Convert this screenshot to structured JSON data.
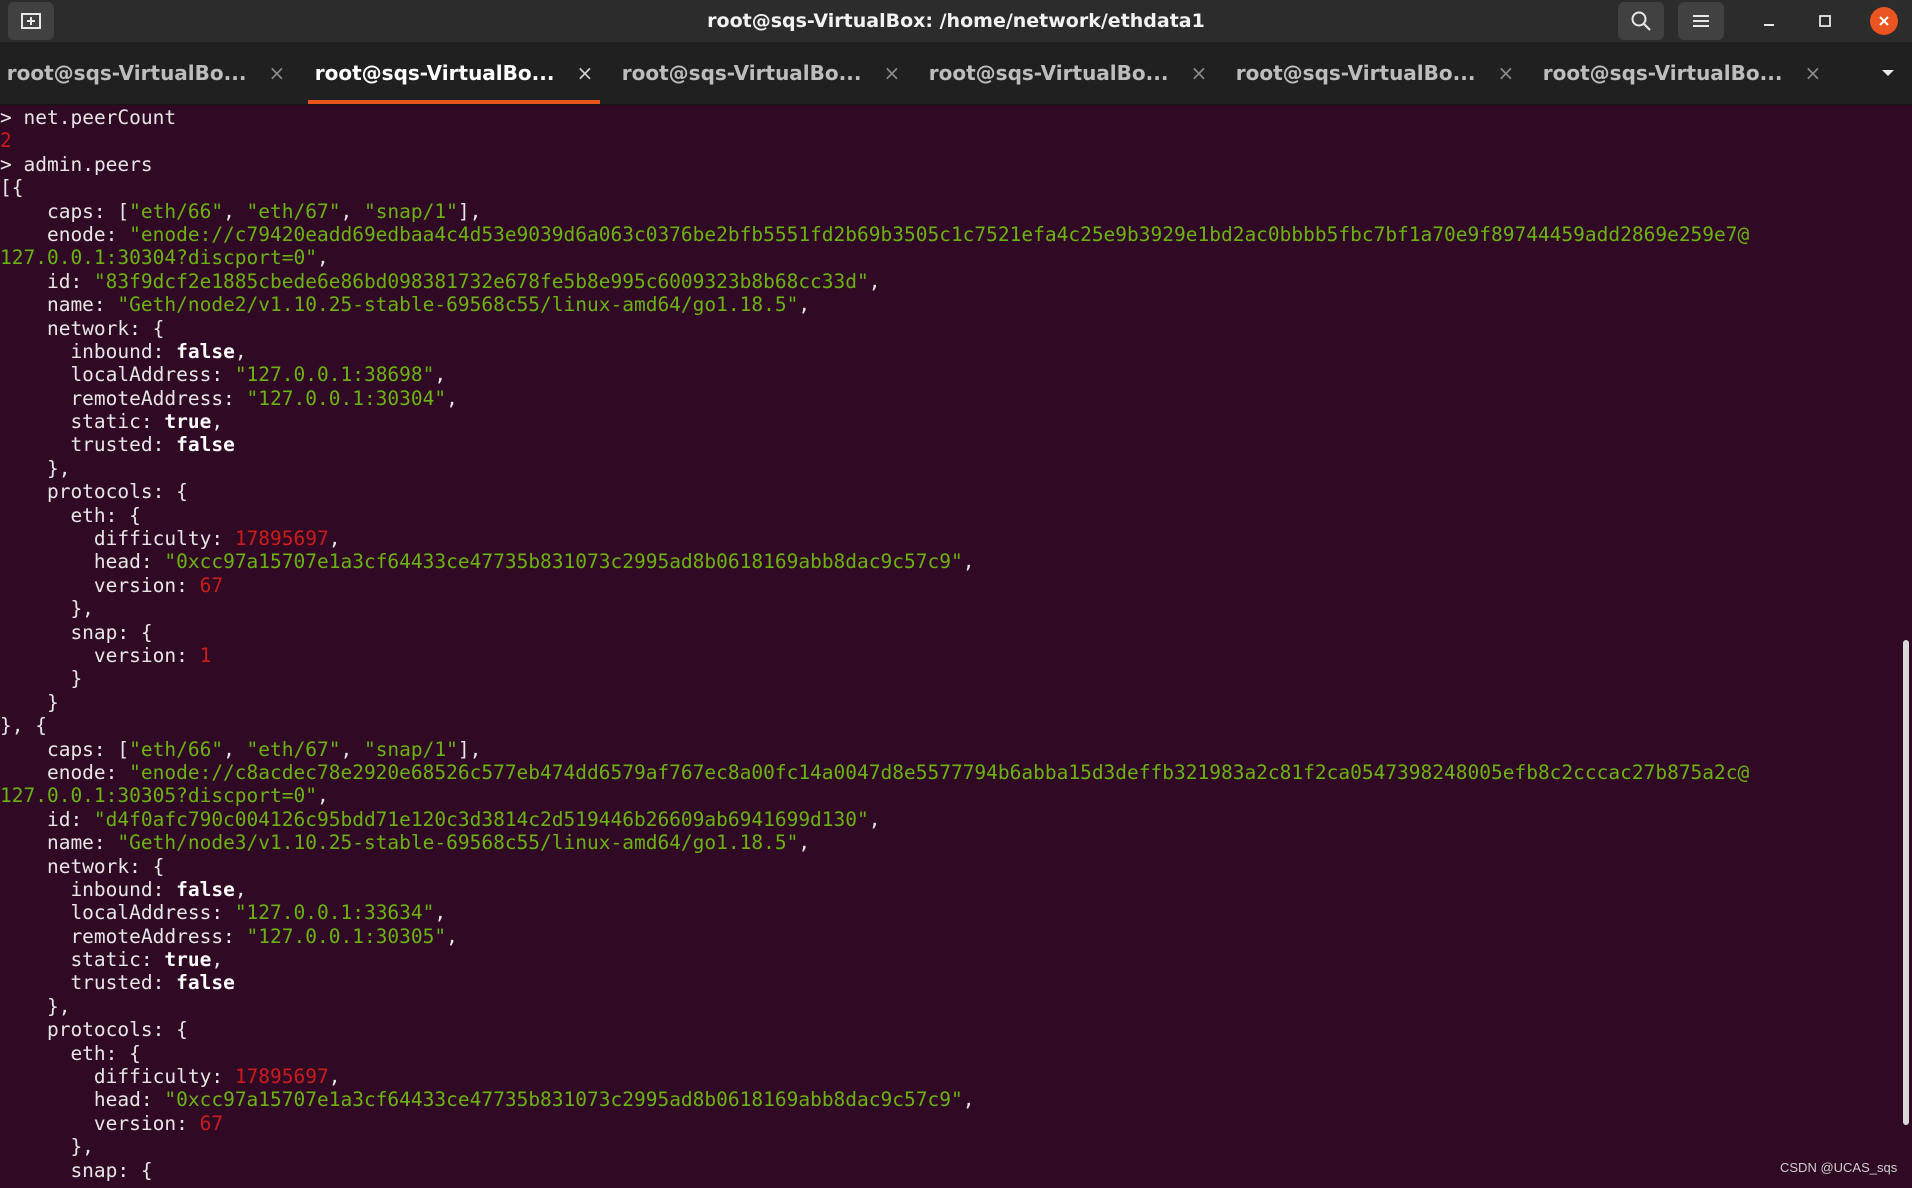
{
  "window": {
    "title": "root@sqs-VirtualBox: /home/network/ethdata1"
  },
  "tabs": [
    {
      "label": "root@sqs-VirtualBo...",
      "active": false
    },
    {
      "label": "root@sqs-VirtualBo...",
      "active": true
    },
    {
      "label": "root@sqs-VirtualBo...",
      "active": false
    },
    {
      "label": "root@sqs-VirtualBo...",
      "active": false
    },
    {
      "label": "root@sqs-VirtualBo...",
      "active": false
    },
    {
      "label": "root@sqs-VirtualBo...",
      "active": false
    }
  ],
  "tab_close_glyph": "×",
  "terminal": {
    "prompt": ">",
    "cmd1": "net.peerCount",
    "peer_count": "2",
    "cmd2": "admin.peers",
    "peers": [
      {
        "caps": [
          "\"eth/66\"",
          "\"eth/67\"",
          "\"snap/1\""
        ],
        "enode_line1": "\"enode://c79420eadd69edbaa4c4d53e9039d6a063c0376be2bfb5551fd2b69b3505c1c7521efa4c25e9b3929e1bd2ac0bbbb5fbc7bf1a70e9f89744459add2869e259e7@",
        "enode_line2": "127.0.0.1:30304?discport=0\"",
        "id": "\"83f9dcf2e1885cbede6e86bd098381732e678fe5b8e995c6009323b8b68cc33d\"",
        "name": "\"Geth/node2/v1.10.25-stable-69568c55/linux-amd64/go1.18.5\"",
        "inbound": "false",
        "localAddress": "\"127.0.0.1:38698\"",
        "remoteAddress": "\"127.0.0.1:30304\"",
        "static": "true",
        "trusted": "false",
        "difficulty": "17895697",
        "head": "\"0xcc97a15707e1a3cf64433ce47735b831073c2995ad8b0618169abb8dac9c57c9\"",
        "eth_version": "67",
        "snap_version": "1"
      },
      {
        "caps": [
          "\"eth/66\"",
          "\"eth/67\"",
          "\"snap/1\""
        ],
        "enode_line1": "\"enode://c8acdec78e2920e68526c577eb474dd6579af767ec8a00fc14a0047d8e5577794b6abba15d3deffb321983a2c81f2ca0547398248005efb8c2cccac27b875a2c@",
        "enode_line2": "127.0.0.1:30305?discport=0\"",
        "id": "\"d4f0afc790c004126c95bdd71e120c3d3814c2d519446b26609ab6941699d130\"",
        "name": "\"Geth/node3/v1.10.25-stable-69568c55/linux-amd64/go1.18.5\"",
        "inbound": "false",
        "localAddress": "\"127.0.0.1:33634\"",
        "remoteAddress": "\"127.0.0.1:30305\"",
        "static": "true",
        "trusted": "false",
        "difficulty": "17895697",
        "head": "\"0xcc97a15707e1a3cf64433ce47735b831073c2995ad8b0618169abb8dac9c57c9\"",
        "eth_version": "67"
      }
    ]
  },
  "watermark": "CSDN @UCAS_sqs",
  "colors": {
    "terminal_bg": "#300a24",
    "string": "#6bb311",
    "number": "#cc1b1b",
    "accent": "#e95420",
    "titlebar": "#2c2c2c",
    "tabbar": "#202020"
  },
  "icons": [
    "new-tab-icon",
    "search-icon",
    "hamburger-menu-icon",
    "minimize-icon",
    "maximize-icon",
    "close-icon",
    "tab-close-icon",
    "tabs-dropdown-icon"
  ]
}
